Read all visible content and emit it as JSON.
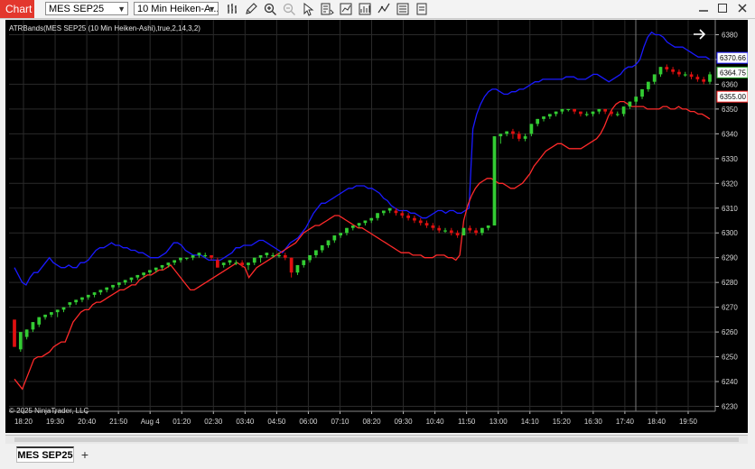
{
  "toolbar": {
    "chart_tab": "Chart",
    "instrument": "MES SEP25",
    "interval": "10 Min Heiken-A..."
  },
  "chart_data": {
    "type": "candlestick",
    "indicator_label": "ATRBands(MES SEP25 (10 Min Heiken-Ashi),true,2,14,3,2)",
    "copyright": "© 2025 NinjaTrader, LLC",
    "ylim": [
      6228,
      6386
    ],
    "y_ticks": [
      6380,
      6370,
      6360,
      6350,
      6340,
      6330,
      6320,
      6310,
      6300,
      6290,
      6280,
      6270,
      6260,
      6250,
      6240,
      6230
    ],
    "x_ticks": [
      "18:20",
      "19:30",
      "20:40",
      "21:50",
      "Aug 4",
      "01:20",
      "02:30",
      "03:40",
      "04:50",
      "06:00",
      "07:10",
      "08:20",
      "09:30",
      "10:40",
      "11:50",
      "13:00",
      "14:10",
      "15:20",
      "16:30",
      "17:40",
      "18:40",
      "19:50"
    ],
    "price_markers": [
      {
        "value": 6370.66,
        "label": "6370.66",
        "color": "#1a1aff"
      },
      {
        "value": 6364.75,
        "label": "6364.75",
        "color": "#1e9e1e"
      },
      {
        "value": 6355.0,
        "label": "6355.00",
        "color": "#ff2a2a"
      }
    ],
    "upper_band_color": "#1a1aff",
    "lower_band_color": "#ff2a2a",
    "up_color": "#33cc33",
    "down_color": "#e01010",
    "upper_band": [
      6286,
      6283,
      6280,
      6279,
      6282,
      6284,
      6284,
      6286,
      6288,
      6290,
      6288,
      6287,
      6286,
      6286,
      6287,
      6286,
      6286,
      6288,
      6288,
      6289,
      6291,
      6293,
      6294,
      6294,
      6295,
      6296,
      6295,
      6295,
      6294,
      6294,
      6293,
      6293,
      6292,
      6292,
      6291,
      6290,
      6290,
      6290,
      6291,
      6292,
      6294,
      6296,
      6296,
      6295,
      6293,
      6292,
      6291,
      6291,
      6291,
      6290,
      6289,
      6289,
      6289,
      6289,
      6290,
      6291,
      6292,
      6294,
      6294,
      6295,
      6295,
      6295,
      6296,
      6297,
      6297,
      6296,
      6295,
      6294,
      6293,
      6292,
      6294,
      6296,
      6297,
      6298,
      6300,
      6302,
      6305,
      6308,
      6310,
      6312,
      6312,
      6313,
      6314,
      6315,
      6316,
      6317,
      6318,
      6318,
      6319,
      6319,
      6319,
      6318,
      6318,
      6317,
      6316,
      6314,
      6313,
      6311,
      6310,
      6309,
      6309,
      6309,
      6308,
      6308,
      6307,
      6306,
      6306,
      6307,
      6308,
      6309,
      6309,
      6308,
      6309,
      6309,
      6308,
      6308,
      6309,
      6310,
      6342,
      6348,
      6352,
      6355,
      6357,
      6358,
      6358,
      6357,
      6356,
      6356,
      6357,
      6357,
      6358,
      6358,
      6359,
      6360,
      6361,
      6361,
      6362,
      6362,
      6362,
      6362,
      6362,
      6362,
      6363,
      6363,
      6363,
      6362,
      6362,
      6362,
      6363,
      6364,
      6364,
      6363,
      6362,
      6361,
      6362,
      6363,
      6364,
      6366,
      6367,
      6367,
      6368,
      6370,
      6375,
      6379,
      6381,
      6380,
      6380,
      6379,
      6377,
      6376,
      6375,
      6375,
      6375,
      6374,
      6373,
      6372,
      6371,
      6371,
      6371,
      6370
    ],
    "lower_band": [
      6241,
      6239,
      6237,
      6241,
      6245,
      6249,
      6250,
      6250,
      6251,
      6252,
      6254,
      6255,
      6256,
      6256,
      6260,
      6264,
      6266,
      6268,
      6269,
      6269,
      6271,
      6272,
      6272,
      6273,
      6274,
      6275,
      6276,
      6277,
      6277,
      6278,
      6279,
      6279,
      6281,
      6282,
      6283,
      6283,
      6284,
      6285,
      6285,
      6286,
      6287,
      6285,
      6283,
      6281,
      6279,
      6277,
      6277,
      6278,
      6279,
      6280,
      6281,
      6282,
      6283,
      6284,
      6285,
      6286,
      6287,
      6288,
      6287,
      6286,
      6282,
      6284,
      6286,
      6287,
      6288,
      6289,
      6290,
      6291,
      6292,
      6293,
      6294,
      6295,
      6296,
      6298,
      6300,
      6301,
      6302,
      6303,
      6303,
      6304,
      6305,
      6306,
      6307,
      6307,
      6306,
      6305,
      6304,
      6303,
      6302,
      6302,
      6301,
      6300,
      6299,
      6298,
      6297,
      6296,
      6295,
      6294,
      6293,
      6292,
      6292,
      6292,
      6291,
      6291,
      6291,
      6290,
      6290,
      6290,
      6291,
      6291,
      6291,
      6290,
      6290,
      6289,
      6291,
      6305,
      6311,
      6315,
      6318,
      6320,
      6321,
      6322,
      6322,
      6321,
      6320,
      6320,
      6319,
      6318,
      6318,
      6319,
      6320,
      6322,
      6324,
      6327,
      6329,
      6331,
      6333,
      6334,
      6335,
      6336,
      6336,
      6335,
      6334,
      6334,
      6334,
      6334,
      6335,
      6336,
      6337,
      6338,
      6340,
      6343,
      6347,
      6350,
      6352,
      6353,
      6353,
      6352,
      6351,
      6351,
      6351,
      6351,
      6350,
      6350,
      6350,
      6350,
      6351,
      6351,
      6350,
      6350,
      6351,
      6350,
      6350,
      6349,
      6349,
      6348,
      6348,
      6347,
      6346
    ],
    "candles": [
      [
        6265,
        6265,
        6254,
        6254
      ],
      [
        6253,
        6260,
        6252,
        6260
      ],
      [
        6258,
        6261,
        6257,
        6261
      ],
      [
        6261,
        6264,
        6260,
        6264
      ],
      [
        6263,
        6266,
        6262,
        6266
      ],
      [
        6266,
        6267,
        6265,
        6267
      ],
      [
        6267,
        6268,
        6266,
        6268
      ],
      [
        6268,
        6269,
        6266,
        6269
      ],
      [
        6269,
        6270,
        6268,
        6270
      ],
      [
        6271,
        6272,
        6270,
        6272
      ],
      [
        6272,
        6273,
        6271,
        6273
      ],
      [
        6273,
        6274,
        6272,
        6274
      ],
      [
        6274,
        6275,
        6273,
        6275
      ],
      [
        6275,
        6276,
        6274,
        6276
      ],
      [
        6276,
        6277,
        6275,
        6277
      ],
      [
        6277,
        6278,
        6276,
        6278
      ],
      [
        6278,
        6279,
        6277,
        6279
      ],
      [
        6279,
        6280,
        6278,
        6280
      ],
      [
        6280,
        6281,
        6279,
        6281
      ],
      [
        6281,
        6282,
        6280,
        6282
      ],
      [
        6282,
        6283,
        6281,
        6283
      ],
      [
        6283,
        6284,
        6282,
        6284
      ],
      [
        6284,
        6285,
        6283,
        6285
      ],
      [
        6285,
        6286,
        6284,
        6286
      ],
      [
        6286,
        6287,
        6285,
        6287
      ],
      [
        6287,
        6288,
        6286,
        6288
      ],
      [
        6288,
        6289,
        6287,
        6289
      ],
      [
        6289,
        6290,
        6288,
        6290
      ],
      [
        6290,
        6290,
        6289,
        6290
      ],
      [
        6290,
        6291,
        6289,
        6291
      ],
      [
        6291,
        6292,
        6290,
        6292
      ],
      [
        6291,
        6292,
        6290,
        6291
      ],
      [
        6291,
        6291,
        6289,
        6290
      ],
      [
        6289,
        6290,
        6286,
        6286
      ],
      [
        6287,
        6288,
        6286,
        6288
      ],
      [
        6288,
        6289,
        6287,
        6289
      ],
      [
        6288,
        6289,
        6287,
        6288
      ],
      [
        6288,
        6289,
        6286,
        6287
      ],
      [
        6287,
        6288,
        6285,
        6288
      ],
      [
        6288,
        6290,
        6287,
        6290
      ],
      [
        6290,
        6291,
        6288,
        6291
      ],
      [
        6291,
        6292,
        6290,
        6292
      ],
      [
        6291,
        6292,
        6290,
        6291
      ],
      [
        6291,
        6292,
        6290,
        6291
      ],
      [
        6291,
        6292,
        6289,
        6290
      ],
      [
        6290,
        6290,
        6282,
        6284
      ],
      [
        6284,
        6287,
        6283,
        6287
      ],
      [
        6287,
        6289,
        6286,
        6289
      ],
      [
        6289,
        6291,
        6288,
        6291
      ],
      [
        6291,
        6293,
        6290,
        6293
      ],
      [
        6293,
        6295,
        6292,
        6295
      ],
      [
        6295,
        6297,
        6294,
        6297
      ],
      [
        6297,
        6299,
        6296,
        6299
      ],
      [
        6299,
        6300,
        6298,
        6300
      ],
      [
        6300,
        6302,
        6299,
        6302
      ],
      [
        6302,
        6303,
        6301,
        6303
      ],
      [
        6303,
        6304,
        6302,
        6304
      ],
      [
        6304,
        6305,
        6303,
        6305
      ],
      [
        6305,
        6306,
        6304,
        6306
      ],
      [
        6306,
        6308,
        6305,
        6308
      ],
      [
        6308,
        6309,
        6307,
        6309
      ],
      [
        6309,
        6310,
        6308,
        6310
      ],
      [
        6309,
        6310,
        6307,
        6308
      ],
      [
        6308,
        6309,
        6306,
        6307
      ],
      [
        6307,
        6308,
        6305,
        6306
      ],
      [
        6306,
        6307,
        6304,
        6305
      ],
      [
        6305,
        6306,
        6303,
        6304
      ],
      [
        6304,
        6305,
        6302,
        6303
      ],
      [
        6303,
        6304,
        6301,
        6302
      ],
      [
        6302,
        6303,
        6300,
        6301
      ],
      [
        6301,
        6302,
        6300,
        6301
      ],
      [
        6301,
        6302,
        6299,
        6300
      ],
      [
        6300,
        6301,
        6298,
        6299
      ],
      [
        6299,
        6302,
        6299,
        6302
      ],
      [
        6302,
        6303,
        6300,
        6301
      ],
      [
        6301,
        6302,
        6299,
        6300
      ],
      [
        6300,
        6302,
        6299,
        6302
      ],
      [
        6302,
        6303,
        6301,
        6303
      ],
      [
        6303,
        6304,
        6339,
        6339
      ],
      [
        6339,
        6340,
        6336,
        6340
      ],
      [
        6340,
        6341,
        6339,
        6341
      ],
      [
        6341,
        6342,
        6338,
        6340
      ],
      [
        6340,
        6341,
        6337,
        6338
      ],
      [
        6338,
        6340,
        6337,
        6339
      ],
      [
        6340,
        6344,
        6339,
        6344
      ],
      [
        6344,
        6346,
        6343,
        6346
      ],
      [
        6346,
        6347,
        6345,
        6347
      ],
      [
        6347,
        6348,
        6346,
        6348
      ],
      [
        6348,
        6349,
        6347,
        6349
      ],
      [
        6349,
        6350,
        6348,
        6350
      ],
      [
        6350,
        6350,
        6349,
        6350
      ],
      [
        6350,
        6350,
        6348,
        6349
      ],
      [
        6349,
        6349,
        6347,
        6348
      ],
      [
        6348,
        6349,
        6347,
        6348
      ],
      [
        6348,
        6349,
        6347,
        6349
      ],
      [
        6349,
        6350,
        6348,
        6350
      ],
      [
        6350,
        6350,
        6348,
        6349
      ],
      [
        6349,
        6349,
        6347,
        6348
      ],
      [
        6348,
        6349,
        6347,
        6348
      ],
      [
        6348,
        6351,
        6347,
        6351
      ],
      [
        6351,
        6353,
        6350,
        6353
      ],
      [
        6353,
        6355,
        6352,
        6355
      ],
      [
        6355,
        6358,
        6354,
        6358
      ],
      [
        6358,
        6361,
        6357,
        6361
      ],
      [
        6361,
        6364,
        6360,
        6364
      ],
      [
        6364,
        6367,
        6363,
        6367
      ],
      [
        6367,
        6368,
        6365,
        6366
      ],
      [
        6366,
        6367,
        6364,
        6365
      ],
      [
        6365,
        6366,
        6363,
        6364
      ],
      [
        6364,
        6365,
        6363,
        6364
      ],
      [
        6364,
        6365,
        6362,
        6363
      ],
      [
        6363,
        6364,
        6361,
        6362
      ],
      [
        6362,
        6363,
        6360,
        6361
      ],
      [
        6361,
        6365,
        6360,
        6364
      ]
    ]
  },
  "footer": {
    "instrument_tab": "MES SEP25",
    "add_tab": "+"
  }
}
